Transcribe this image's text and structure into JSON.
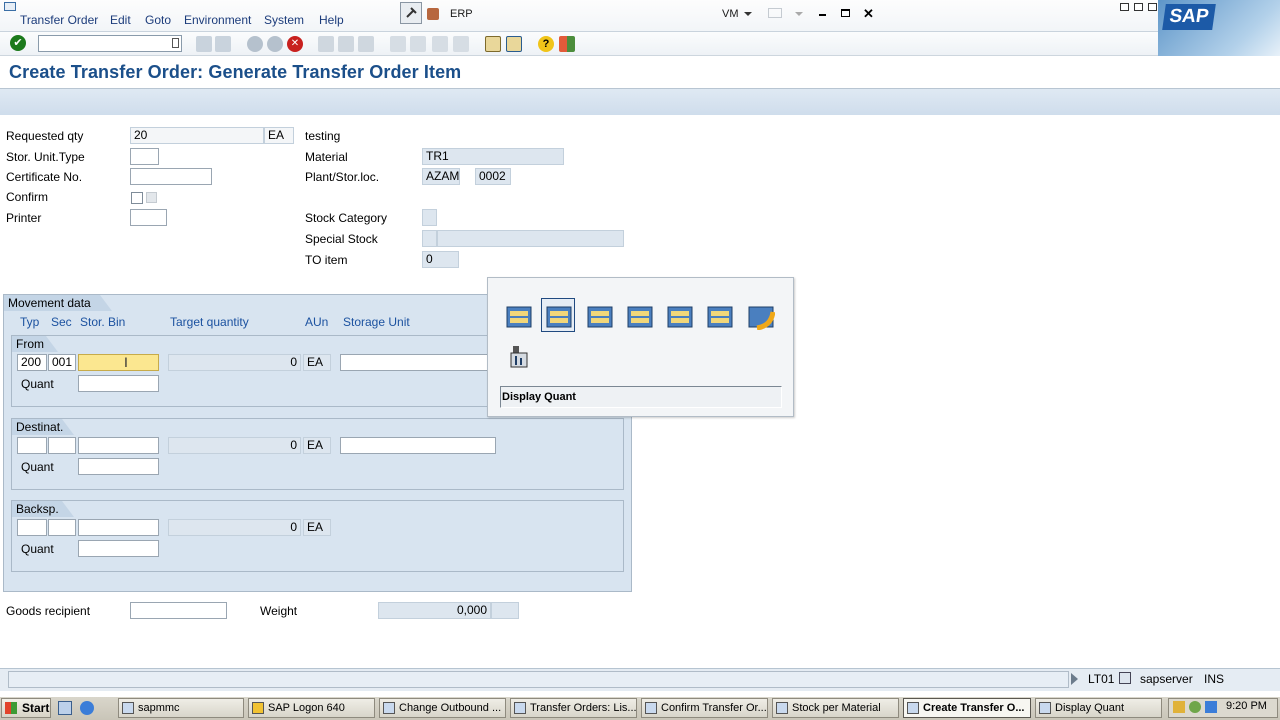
{
  "window": {
    "app_title": "ERP",
    "vm_label": "VM",
    "menu": [
      "Transfer Order",
      "Edit",
      "Goto",
      "Environment",
      "System",
      "Help"
    ],
    "brand": "SAP"
  },
  "screen": {
    "title": "Create Transfer Order: Generate Transfer Order Item"
  },
  "header": {
    "requested_qty_label": "Requested qty",
    "requested_qty_value": "20",
    "requested_qty_unit": "EA",
    "text": "testing",
    "stor_unit_type_label": "Stor. Unit.Type",
    "stor_unit_type_value": "",
    "certificate_label": "Certificate No.",
    "certificate_value": "",
    "confirm_label": "Confirm",
    "printer_label": "Printer",
    "printer_value": "",
    "material_label": "Material",
    "material_value": "TR1",
    "plant_label": "Plant/Stor.loc.",
    "plant_value": "AZAM",
    "storloc_value": "0002",
    "stock_category_label": "Stock Category",
    "special_stock_label": "Special Stock",
    "to_item_label": "TO item",
    "to_item_value": "0"
  },
  "movement": {
    "title": "Movement data",
    "columns": [
      "Typ",
      "Sec",
      "Stor. Bin",
      "Target quantity",
      "AUn",
      "Storage Unit"
    ],
    "from": {
      "title": "From",
      "typ": "200",
      "sec": "001",
      "bin": "",
      "qty": "0",
      "unit": "EA",
      "quant_label": "Quant"
    },
    "dest": {
      "title": "Destinat.",
      "qty": "0",
      "unit": "EA",
      "quant_label": "Quant"
    },
    "backsp": {
      "title": "Backsp.",
      "qty": "0",
      "unit": "EA",
      "quant_label": "Quant"
    }
  },
  "footer": {
    "goods_recipient_label": "Goods recipient",
    "goods_recipient_value": "",
    "weight_label": "Weight",
    "weight_value": "0,000"
  },
  "popup": {
    "status_text": "Display Quant",
    "icons": [
      "bin-icon",
      "bin-selected-icon",
      "bin-icon",
      "bin-icon",
      "bin-icon",
      "bin-icon",
      "bin-refresh-icon",
      "display-quant-icon"
    ]
  },
  "statusbar": {
    "transaction": "LT01",
    "server": "sapserver",
    "mode": "INS"
  },
  "taskbar": {
    "start": "Start",
    "items": [
      "sapmmc",
      "SAP Logon 640",
      "Change Outbound ...",
      "Transfer Orders: Lis...",
      "Confirm Transfer Or...",
      "Stock per Material",
      "Create Transfer O...",
      "Display Quant"
    ],
    "clock": "9:20 PM"
  },
  "colors": {
    "title_blue": "#1b4f8a",
    "panel_blue": "#d8e4f0",
    "highlight_yellow": "#fbe790"
  }
}
